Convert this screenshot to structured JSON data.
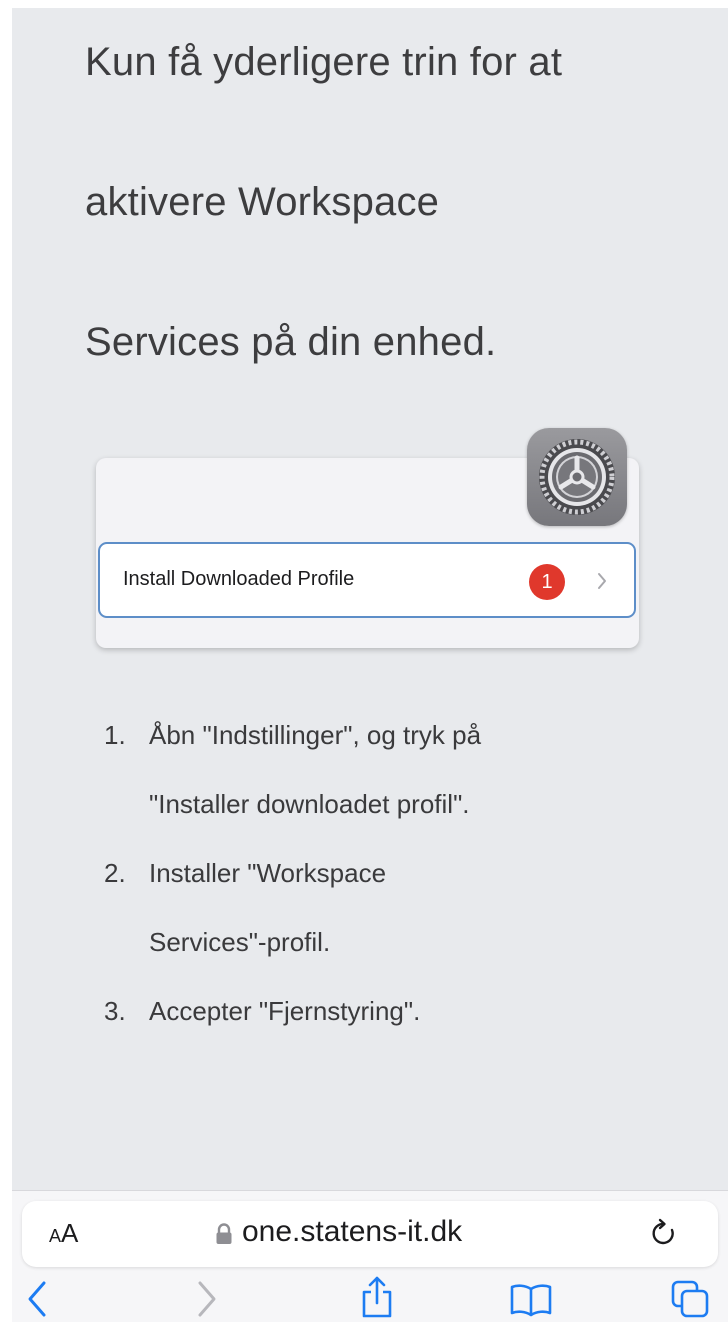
{
  "heading": {
    "lines": [
      "Kun få yderligere trin for at",
      "aktivere Workspace",
      "Services på din enhed."
    ]
  },
  "illustration": {
    "row_label": "Install Downloaded Profile",
    "badge_count": "1",
    "icon": "settings-gear-icon"
  },
  "steps": [
    {
      "num": "1.",
      "line1": "Åbn \"Indstillinger\", og tryk på",
      "line2": "\"Installer downloadet profil\"."
    },
    {
      "num": "2.",
      "line1": "Installer \"Workspace",
      "line2": "Services\"-profil."
    },
    {
      "num": "3.",
      "line1": "Accepter \"Fjernstyring\"."
    }
  ],
  "browser": {
    "text_size_label_small": "A",
    "text_size_label_large": "A",
    "url": "one.statens-it.dk",
    "icons": [
      "lock-icon",
      "reload-icon",
      "back-icon",
      "forward-icon",
      "share-icon",
      "bookmarks-icon",
      "tabs-icon"
    ]
  },
  "colors": {
    "page_background": "#e8eaed",
    "badge": "#e0382c",
    "row_border": "#5d8ec8",
    "toolbar_accent": "#1d7cf2"
  }
}
